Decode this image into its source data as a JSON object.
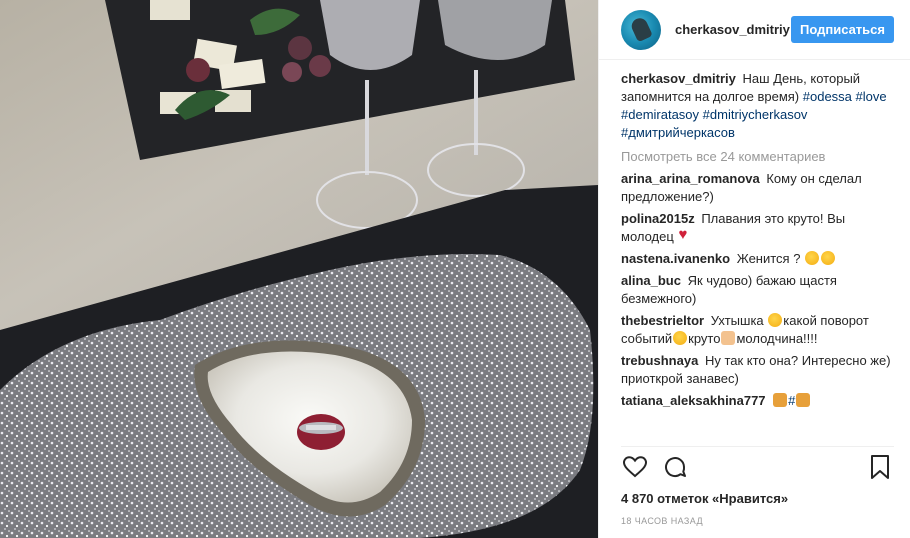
{
  "post": {
    "author": "cherkasov_dmitriy",
    "follow_label": "Подписаться",
    "caption": {
      "user": "cherkasov_dmitriy",
      "text": "Наш День, который запомнится на долгое время)",
      "tags": [
        "#odessa",
        "#love",
        "#demiratasoy",
        "#dmitriycherkasov",
        "#дмитрийчеркасов"
      ]
    },
    "view_all_comments": "Посмотреть все 24 комментариев",
    "comments": [
      {
        "user": "arina_arina_romanova",
        "text": "Кому он сделал предложение?)"
      },
      {
        "user": "polina2015z",
        "text": "Плавания это круто! Вы молодец",
        "text2": ""
      },
      {
        "user": "nastena.ivanenko",
        "text": "Женится ?",
        "text2": ""
      },
      {
        "user": "alina_buc",
        "text": "Як чудово) бажаю щастя безмежного)"
      },
      {
        "user": "thebestrieltor",
        "text": "Ухтышка",
        "text2": "какой поворот событий",
        "text3": "круто",
        "text4": "молодчина!!!!"
      },
      {
        "user": "trebushnaya",
        "text": "Ну так кто она? Интересно же) приоткрой занавес)"
      },
      {
        "user": "tatiana_aleksakhina777",
        "text": "#",
        "text2": ""
      }
    ],
    "likes": "4 870 отметок «Нравится»",
    "time": "18 часов назад"
  },
  "icons": {
    "like": "heart-outline-icon",
    "comment": "speech-bubble-icon",
    "save": "bookmark-icon"
  },
  "colors": {
    "accent": "#3897f0",
    "hashtag": "#003569",
    "muted": "#999999"
  }
}
